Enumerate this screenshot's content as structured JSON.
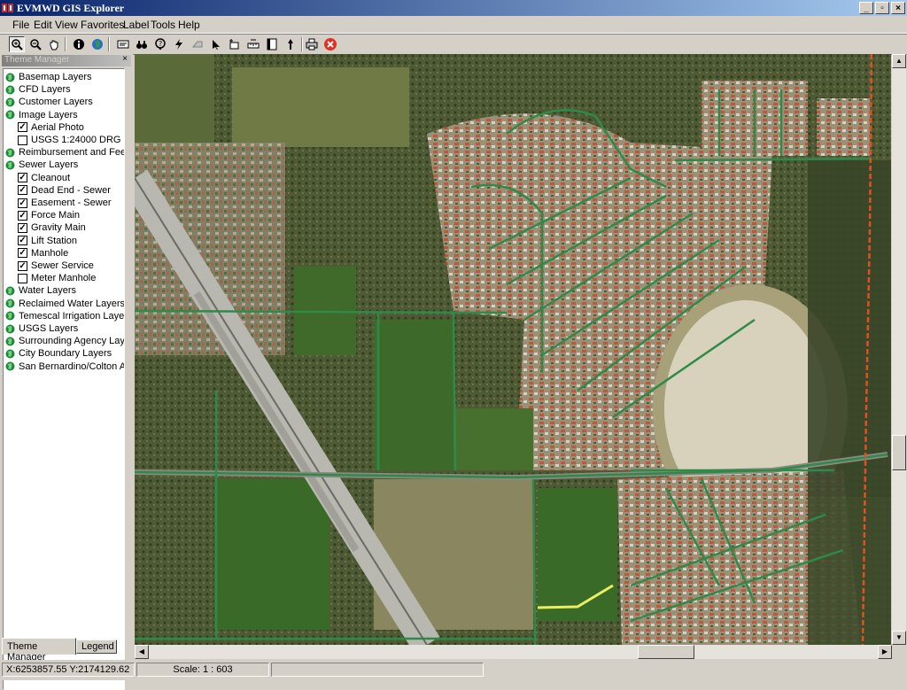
{
  "window": {
    "title": "EVMWD GIS Explorer"
  },
  "menu": [
    "File",
    "Edit",
    "View",
    "Favorites",
    "Label",
    "Tools",
    "Help"
  ],
  "toolbar": {
    "tools": [
      "zoom-in-icon",
      "zoom-out-icon",
      "pan-hand-icon",
      "info-icon",
      "globe-icon",
      "identify-window-icon",
      "binoculars-icon",
      "query-icon",
      "lightning-icon",
      "eraser-icon",
      "select-arrow-icon",
      "buffer-icon",
      "measure-icon",
      "layout-icon",
      "north-arrow-icon",
      "print-icon",
      "stop-icon"
    ]
  },
  "theme_manager": {
    "title": "Theme Manager",
    "items": [
      {
        "type": "group",
        "label": "Basemap Layers"
      },
      {
        "type": "group",
        "label": "CFD Layers"
      },
      {
        "type": "group",
        "label": "Customer Layers"
      },
      {
        "type": "group",
        "label": "Image Layers"
      },
      {
        "type": "layer",
        "label": "Aerial Photo",
        "checked": true
      },
      {
        "type": "layer",
        "label": "USGS 1:24000 DRG",
        "checked": false
      },
      {
        "type": "group",
        "label": "Reimbursement and Fee Cre"
      },
      {
        "type": "group",
        "label": "Sewer Layers"
      },
      {
        "type": "layer",
        "label": "Cleanout",
        "checked": true
      },
      {
        "type": "layer",
        "label": "Dead End - Sewer",
        "checked": true
      },
      {
        "type": "layer",
        "label": "Easement - Sewer",
        "checked": true
      },
      {
        "type": "layer",
        "label": "Force Main",
        "checked": true
      },
      {
        "type": "layer",
        "label": "Gravity Main",
        "checked": true
      },
      {
        "type": "layer",
        "label": "Lift Station",
        "checked": true
      },
      {
        "type": "layer",
        "label": "Manhole",
        "checked": true
      },
      {
        "type": "layer",
        "label": "Sewer Service",
        "checked": true
      },
      {
        "type": "layer",
        "label": "Meter Manhole",
        "checked": false
      },
      {
        "type": "group",
        "label": "Water Layers"
      },
      {
        "type": "group",
        "label": "Reclaimed Water Layers"
      },
      {
        "type": "group",
        "label": "Temescal Irrigation Layers"
      },
      {
        "type": "group",
        "label": "USGS Layers"
      },
      {
        "type": "group",
        "label": "Surrounding Agency Layers"
      },
      {
        "type": "group",
        "label": "City Boundary Layers"
      },
      {
        "type": "group",
        "label": "San Bernardino/Colton Area"
      }
    ],
    "tabs": [
      "Theme Manager",
      "Legend"
    ]
  },
  "map": {
    "description_icon": "aerial-map"
  },
  "status": {
    "coords": "X:6253857.55 Y:2174129.62",
    "scale": "Scale: 1 : 603"
  },
  "colors": {
    "title_start": "#0a246a",
    "title_end": "#a6caf0",
    "sewer_line": "#2f8a4a",
    "boundary": "#e05020"
  }
}
